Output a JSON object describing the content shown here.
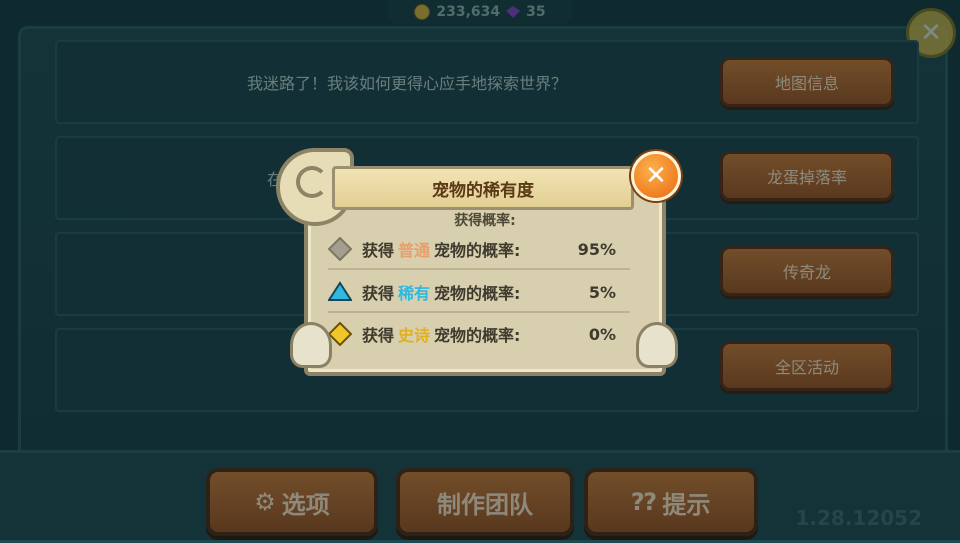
{
  "currency": {
    "coins": "233,634",
    "gems": "35"
  },
  "faq": {
    "q1": "我迷路了！我该如何更得心应手地探索世界？",
    "q2_partial": "在"
  },
  "side_buttons": [
    "地图信息",
    "龙蛋掉落率",
    "传奇龙",
    "全区活动"
  ],
  "bottom_buttons": {
    "options": "选项",
    "team": "制作团队",
    "hints": "提示"
  },
  "version": "1.28.12052",
  "dialog": {
    "title": "宠物的稀有度",
    "subtitle": "获得概率:",
    "rows": [
      {
        "prefix": "获得",
        "rarity": "普通",
        "suffix": "宠物的概率:",
        "value": "95%",
        "color": "#e8a06a",
        "icon": "gray-diamond-icon"
      },
      {
        "prefix": "获得",
        "rarity": "稀有",
        "suffix": "宠物的概率:",
        "value": "5%",
        "color": "#2fb8e0",
        "icon": "blue-triangle-icon"
      },
      {
        "prefix": "获得",
        "rarity": "史诗",
        "suffix": "宠物的概率:",
        "value": "0%",
        "color": "#e0b020",
        "icon": "yellow-diamond-icon"
      }
    ]
  },
  "colors": {
    "accent_orange": "#c87a35",
    "background_teal": "#143a3f",
    "dialog_parchment": "#d8cfae"
  }
}
